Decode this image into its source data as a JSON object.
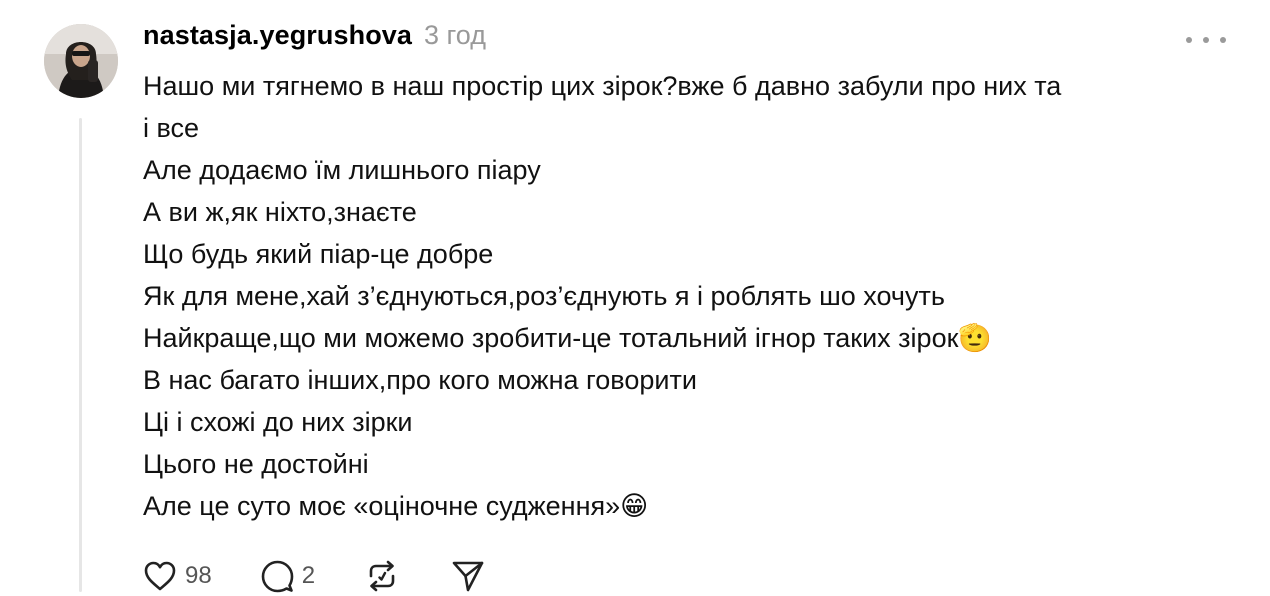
{
  "post": {
    "username": "nastasja.yegrushova",
    "timestamp": "3 год",
    "lines": [
      "Нашо ми тягнемо в наш простір цих зірок?вже б давно забули про них та",
      "і все",
      "Але додаємо їм лишнього піару",
      "А ви ж,як ніхто,знаєте",
      "Що будь який піар-це добре",
      "Як для мене,хай з’єднуються,роз’єднують я і роблять шо хочуть",
      "Найкраще,що ми можемо зробити-це тотальний ігнор таких зірок🫡",
      "В нас багато інших,про кого можна говорити",
      "Ці і схожі до них зірки",
      "Цього не достойні",
      "Але це суто моє «оціночне судження»😁"
    ]
  },
  "actions": {
    "likes": "98",
    "replies": "2"
  },
  "icons": [
    "more-dots-icon",
    "heart-icon",
    "comment-icon",
    "repost-icon",
    "share-icon"
  ],
  "colors": {
    "text": "#111111",
    "muted": "#999999",
    "thread_line": "#e6e6e6"
  }
}
